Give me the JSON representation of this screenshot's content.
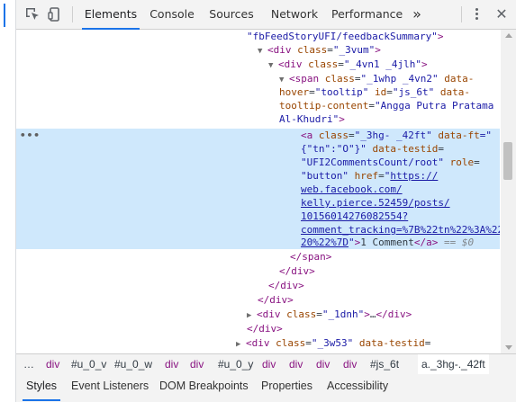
{
  "toolbar": {
    "tabs": [
      "Elements",
      "Console",
      "Sources",
      "Network",
      "Performance"
    ],
    "active_tab": "Elements",
    "more_glyph": "»",
    "close_glyph": "✕",
    "icons": [
      "inspect-element-icon",
      "device-toolbar-icon",
      "more-tabs-icon",
      "kebab-menu-icon",
      "close-icon"
    ],
    "accent_color": "#1a73e8"
  },
  "tree": {
    "l0": {
      "val": "\"fbFeedStoryUFI/feedbackSummary\"",
      "gt": ">"
    },
    "l1": {
      "open": "<",
      "tag": "div",
      "attr": "class",
      "eq": "=",
      "val": "\"_3vum\"",
      "gt": ">"
    },
    "l2": {
      "open": "<",
      "tag": "div",
      "attr": "class",
      "eq": "=",
      "val": "\"_4vn1 _4jlh\"",
      "gt": ">"
    },
    "l3": {
      "open": "<",
      "tag": "span",
      "attr1": "class",
      "eq": "=",
      "val1": "\"_1whp _4vn2\"",
      "attr2": "data-"
    },
    "l4": {
      "attr2": "hover",
      "eq": "=",
      "val2": "\"tooltip\"",
      "attr3": "id",
      "val3": "\"js_6t\"",
      "attr4": "data-"
    },
    "l5": {
      "attr4": "tooltip-content",
      "eq": "=",
      "val4": "\"Angga Putra Pratama"
    },
    "l6": {
      "val4": "Al-Khudri\"",
      "gt": ">"
    },
    "selected": {
      "ellipsis": "•••",
      "l7": {
        "open": "<",
        "tag": "a",
        "attr1": "class",
        "eq": "=",
        "val1": "\"_3hg- _42ft\"",
        "attr2": "data-ft",
        "eq2": "=\""
      },
      "l8": {
        "val2": "{\"tn\":\"O\"}\"",
        "attr3": "data-testid",
        "eq": "="
      },
      "l9": {
        "val3": "\"UFI2CommentsCount/root\"",
        "attr4": "role",
        "eq": "="
      },
      "l10": {
        "val4": "\"button\"",
        "attr5": "href",
        "eq": "=",
        "q": "\"",
        "link": "https://"
      },
      "l11": {
        "link": "web.facebook.com/"
      },
      "l12": {
        "link": "kelly.pierce.52459/posts/"
      },
      "l13": {
        "link": "10156014276082554?"
      },
      "l14": {
        "link": "comment_tracking=%7B%22tn%22%3A%22"
      },
      "l15": {
        "link": "20%22%7D",
        "q": "\"",
        "gt": ">",
        "text": "1 Comment",
        "close": "</a>",
        "sep": " == ",
        "ref": "$0"
      }
    },
    "l16": {
      "close": "</span>"
    },
    "l17": {
      "close": "</div>"
    },
    "l18": {
      "close": "</div>"
    },
    "l19": {
      "close": "</div>"
    },
    "l20": {
      "open": "<",
      "tag": "div",
      "attr": "class",
      "eq": "=",
      "val": "\"_1dnh\"",
      "gt": ">",
      "dots": "…",
      "close": "</div>"
    },
    "l21": {
      "close": "</div>"
    },
    "l22": {
      "open": "<",
      "tag": "div",
      "attr1": "class",
      "eq": "=",
      "val": "\"_3w53\"",
      "attr2": "data-testid",
      "eq2": "="
    }
  },
  "breadcrumbs": [
    "…",
    "div",
    "#u_0_v",
    "#u_0_w",
    "div",
    "div",
    "#u_0_y",
    "div",
    "div",
    "div",
    "div",
    "#js_6t",
    "a._3hg-._42ft"
  ],
  "subtabs": [
    "Styles",
    "Event Listeners",
    "DOM Breakpoints",
    "Properties",
    "Accessibility"
  ],
  "active_subtab": "Styles"
}
